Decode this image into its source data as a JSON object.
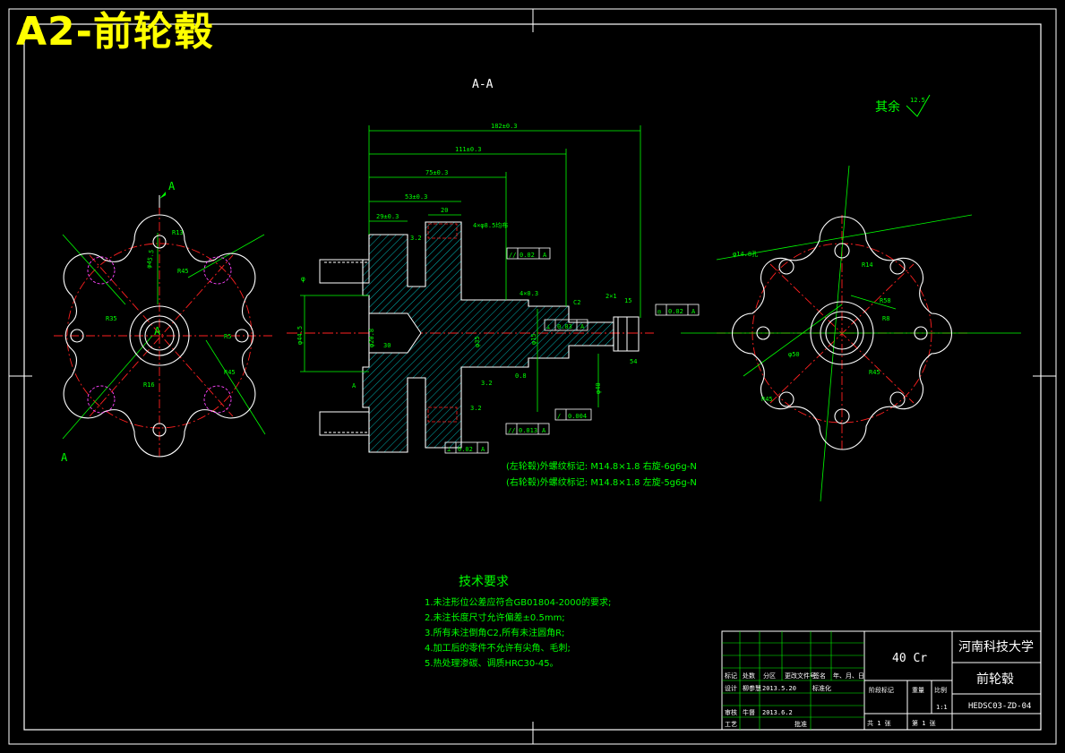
{
  "overlay_title": "A2-前轮毂",
  "section_label": "A-A",
  "roughness": {
    "label": "其余",
    "value": "12.5"
  },
  "view_letters": {
    "top": "A",
    "bottom": "A",
    "center": "A"
  },
  "dims": {
    "d182": "182±0.3",
    "d111": "111±0.3",
    "d75": "75±0.3",
    "d53": "53±0.3",
    "d29": "29±0.3",
    "d20": "20",
    "holes": "4×φ8.5均布",
    "d4x0_3": "4×0.3",
    "c2": "C2",
    "d2x1": "2×1",
    "d15": "15",
    "d30": "30",
    "d54": "54",
    "d0_8": "0.8",
    "d3_2a": "3.2",
    "d3_2b": "3.2",
    "d3_2c": "3.2",
    "ra_a": "A",
    "dia_left": "φ44.5",
    "dia_phi": "φ",
    "phi20": "φ20.8",
    "phi35": "φ35",
    "phi15": "φ15",
    "phi40": "φ40"
  },
  "tolerance_frames": [
    {
      "sym": "//",
      "val": "0.02",
      "datum": "A"
    },
    {
      "sym": "◎",
      "val": "0.02",
      "datum": "A"
    },
    {
      "sym": "⊥",
      "val": "0.03",
      "datum": "A"
    },
    {
      "sym": "/",
      "val": "0.004",
      "datum": ""
    },
    {
      "sym": "//",
      "val": "0.013",
      "datum": "A"
    },
    {
      "sym": "⊥",
      "val": "0.02",
      "datum": "A"
    }
  ],
  "left_view_dims": {
    "r1": "R13",
    "r2": "φ45.5",
    "r3": "R45",
    "r4": "R35",
    "r5": "R5",
    "r6": "R45",
    "r7": "R16"
  },
  "right_view_dims": {
    "r1": "φ14.8孔",
    "r2": "R14",
    "r3": "R58",
    "r4": "R8",
    "r5": "φ50",
    "r6": "R45",
    "r7": "R45"
  },
  "thread_notes": [
    "(左轮毂)外螺纹标记: M14.8×1.8  右旋-6g6g-N",
    "(右轮毂)外螺纹标记: M14.8×1.8  左旋-5g6g-N"
  ],
  "tech_req": {
    "title": "技术要求",
    "items": [
      "1.未注形位公差应符合GB01804-2000的要求;",
      "2.未注长度尺寸允许偏差±0.5mm;",
      "3.所有未注倒角C2,所有未注圆角R;",
      "4.加工后的零件不允许有尖角、毛刺;",
      "5.热处理渗碳、调质HRC30-45。"
    ]
  },
  "title_block": {
    "material": "40 Cr",
    "school": "河南科技大学",
    "part_name": "前轮毂",
    "drawing_no": "HEDSC03-ZD-04",
    "scale_label": "比例",
    "scale": "1:1",
    "stage_label": "阶段标记",
    "weight_label": "重量",
    "header_row": [
      "标记",
      "处数",
      "分区",
      "更改文件号",
      "签名",
      "年、月、日"
    ],
    "design_label": "设计",
    "designer": "柳参慧",
    "design_date": "2013.5.20",
    "standard_label": "标准化",
    "review_label": "审核",
    "reviewer": "牛督",
    "review_date": "2013.6.2",
    "process_label": "工艺",
    "approve_label": "批准",
    "sheets": "共  1  张",
    "sheet_no": "第  1  张"
  }
}
